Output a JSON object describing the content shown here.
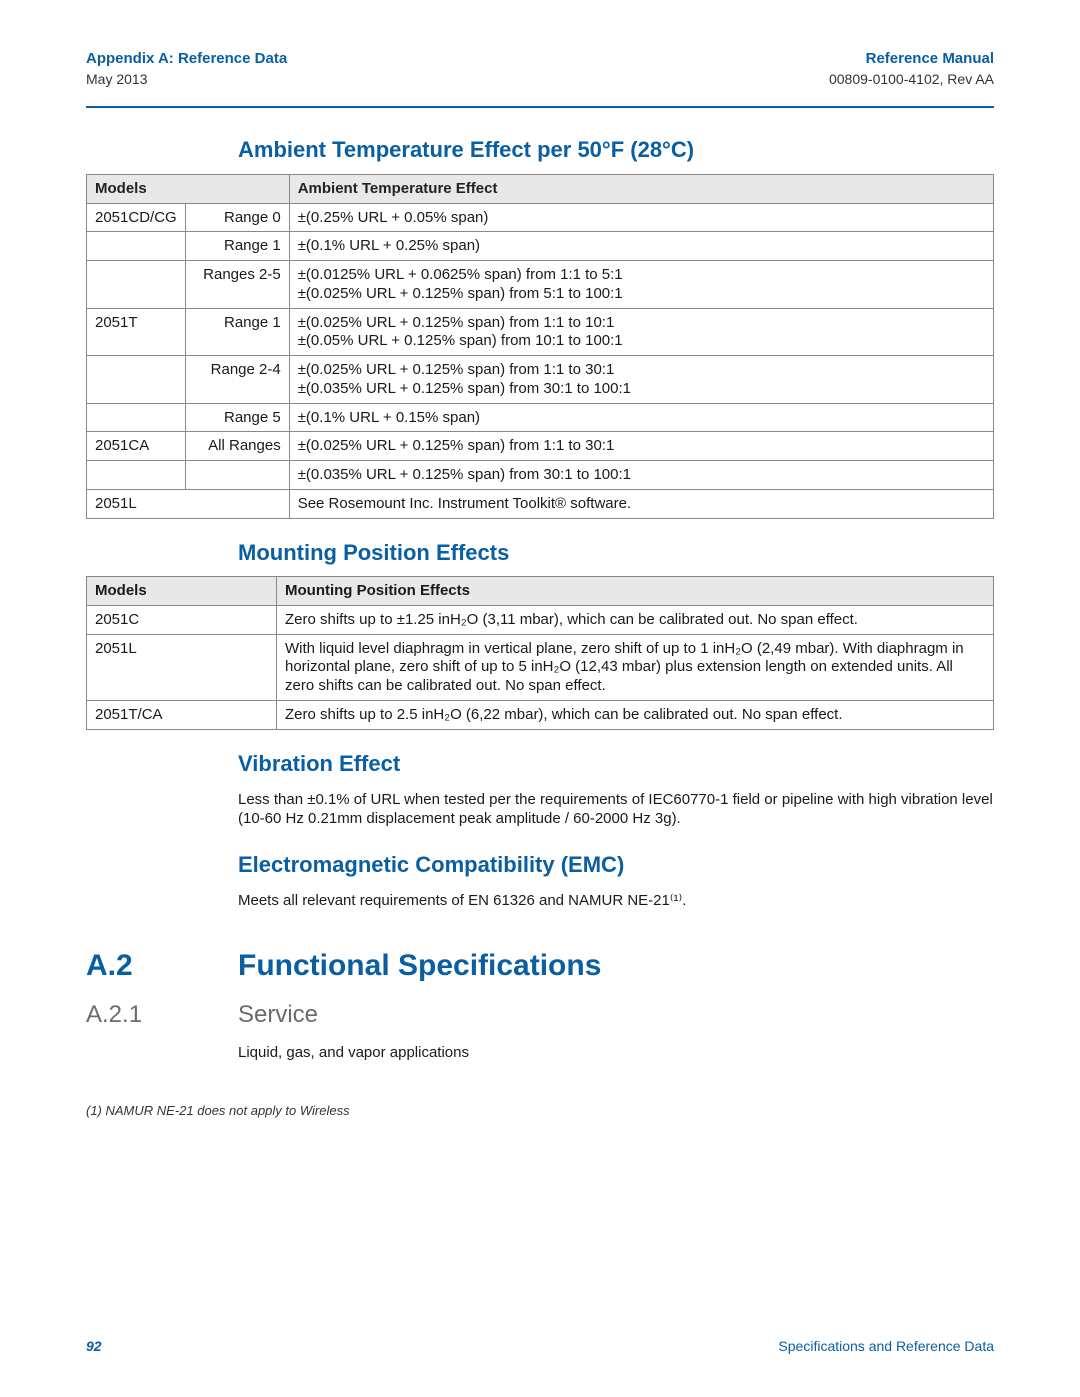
{
  "header": {
    "left_title": "Appendix A: Reference Data",
    "left_sub": "May 2013",
    "right_title": "Reference Manual",
    "right_sub": "00809-0100-4102, Rev AA"
  },
  "sections": {
    "amb_title": "Ambient Temperature Effect per 50°F (28°C)",
    "amb_headers": {
      "models": "Models",
      "effect": "Ambient Temperature Effect"
    },
    "amb_rows": [
      {
        "model": "2051CD/CG",
        "range": "Range 0",
        "effect": "±(0.25% URL + 0.05% span)"
      },
      {
        "model": "",
        "range": "Range 1",
        "effect": "±(0.1% URL + 0.25% span)"
      },
      {
        "model": "",
        "range": "Ranges 2-5",
        "effect": "±(0.0125% URL + 0.0625% span) from 1:1 to 5:1\n±(0.025% URL + 0.125% span) from 5:1 to 100:1"
      },
      {
        "model": "2051T",
        "range": "Range 1",
        "effect": "±(0.025% URL + 0.125% span) from 1:1 to 10:1\n±(0.05% URL + 0.125% span) from 10:1 to 100:1"
      },
      {
        "model": "",
        "range": "Range 2-4",
        "effect": "±(0.025% URL + 0.125% span) from 1:1 to 30:1\n±(0.035% URL + 0.125% span) from 30:1 to 100:1"
      },
      {
        "model": "",
        "range": "Range 5",
        "effect": "±(0.1% URL + 0.15% span)"
      },
      {
        "model": "2051CA",
        "range": "All Ranges",
        "effect": "±(0.025% URL + 0.125% span) from 1:1 to 30:1"
      },
      {
        "model": "",
        "range": "",
        "effect": "±(0.035% URL + 0.125% span) from 30:1 to 100:1"
      },
      {
        "model": "2051L",
        "range": "",
        "effect": "See Rosemount Inc. Instrument Toolkit® software."
      }
    ],
    "mount_title": "Mounting Position Effects",
    "mount_headers": {
      "models": "Models",
      "effect": "Mounting Position Effects"
    },
    "mount_rows": [
      {
        "model": "2051C",
        "effect": "Zero shifts up to ±1.25 inH₂O (3,11 mbar), which can be calibrated out. No span effect."
      },
      {
        "model": "2051L",
        "effect": "With liquid level diaphragm in vertical plane, zero shift of up to 1 inH₂O (2,49 mbar). With diaphragm in horizontal plane, zero shift of up to 5 inH₂O (12,43 mbar) plus extension length on extended units. All zero shifts can be calibrated out. No span effect."
      },
      {
        "model": "2051T/CA",
        "effect": "Zero shifts up to 2.5 inH₂O (6,22 mbar), which can be calibrated out. No span effect."
      }
    ],
    "vib_title": "Vibration Effect",
    "vib_body": "Less than ±0.1% of URL when tested per the requirements of IEC60770-1 field or pipeline with high vibration level (10-60 Hz 0.21mm displacement peak amplitude / 60-2000 Hz 3g).",
    "emc_title": "Electromagnetic Compatibility (EMC)",
    "emc_body": "Meets all relevant requirements of EN 61326 and NAMUR NE-21⁽¹⁾.",
    "a2_num": "A.2",
    "a2_title": "Functional Specifications",
    "a21_num": "A.2.1",
    "a21_title": "Service",
    "a21_body": "Liquid, gas, and vapor applications",
    "footnote": "(1)   NAMUR NE-21 does not apply to Wireless"
  },
  "footer": {
    "page": "92",
    "section": "Specifications and Reference Data"
  }
}
